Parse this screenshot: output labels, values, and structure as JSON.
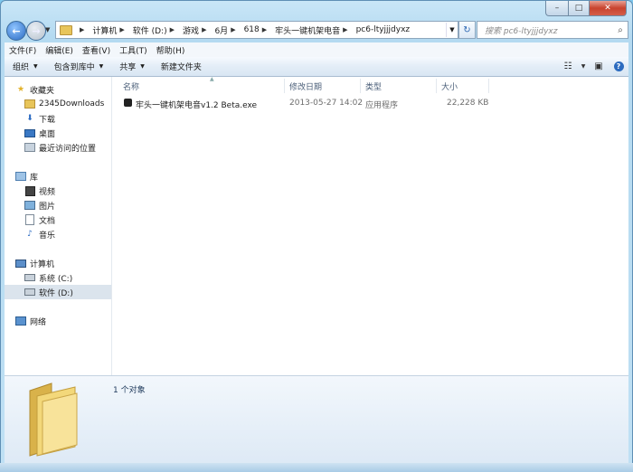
{
  "window": {
    "caption": {
      "minimize": "–",
      "maximize": "□",
      "close": "✕"
    }
  },
  "nav": {
    "back_icon": "arrow-left-icon",
    "forward_icon": "arrow-right-icon",
    "breadcrumbs": [
      "计算机",
      "软件 (D:)",
      "游戏",
      "6月",
      "618",
      "牢头一键机架电音",
      "pc6-ltyjjjdyxz"
    ],
    "search_placeholder": "搜索 pc6-ltyjjjdyxz"
  },
  "menu": [
    "文件(F)",
    "编辑(E)",
    "查看(V)",
    "工具(T)",
    "帮助(H)"
  ],
  "toolbar": {
    "organize": "组织",
    "include_library": "包含到库中",
    "share": "共享",
    "new_folder": "新建文件夹"
  },
  "sidebar": {
    "favorites": {
      "label": "收藏夹",
      "items": [
        "2345Downloads",
        "下载",
        "桌面",
        "最近访问的位置"
      ]
    },
    "libraries": {
      "label": "库",
      "items": [
        "视频",
        "图片",
        "文档",
        "音乐"
      ]
    },
    "computer": {
      "label": "计算机",
      "items": [
        "系统 (C:)",
        "软件 (D:)"
      ]
    },
    "network": {
      "label": "网络"
    }
  },
  "columns": {
    "name": "名称",
    "date": "修改日期",
    "type": "类型",
    "size": "大小"
  },
  "files": [
    {
      "name": "牢头一键机架电音v1.2 Beta.exe",
      "date": "2013-05-27 14:02",
      "type": "应用程序",
      "size": "22,228 KB"
    }
  ],
  "details": {
    "count": "1 个对象"
  },
  "colors": {
    "accent": "#2a6ac2",
    "selection": "#dbe4ed",
    "folder": "#e8c55a"
  }
}
